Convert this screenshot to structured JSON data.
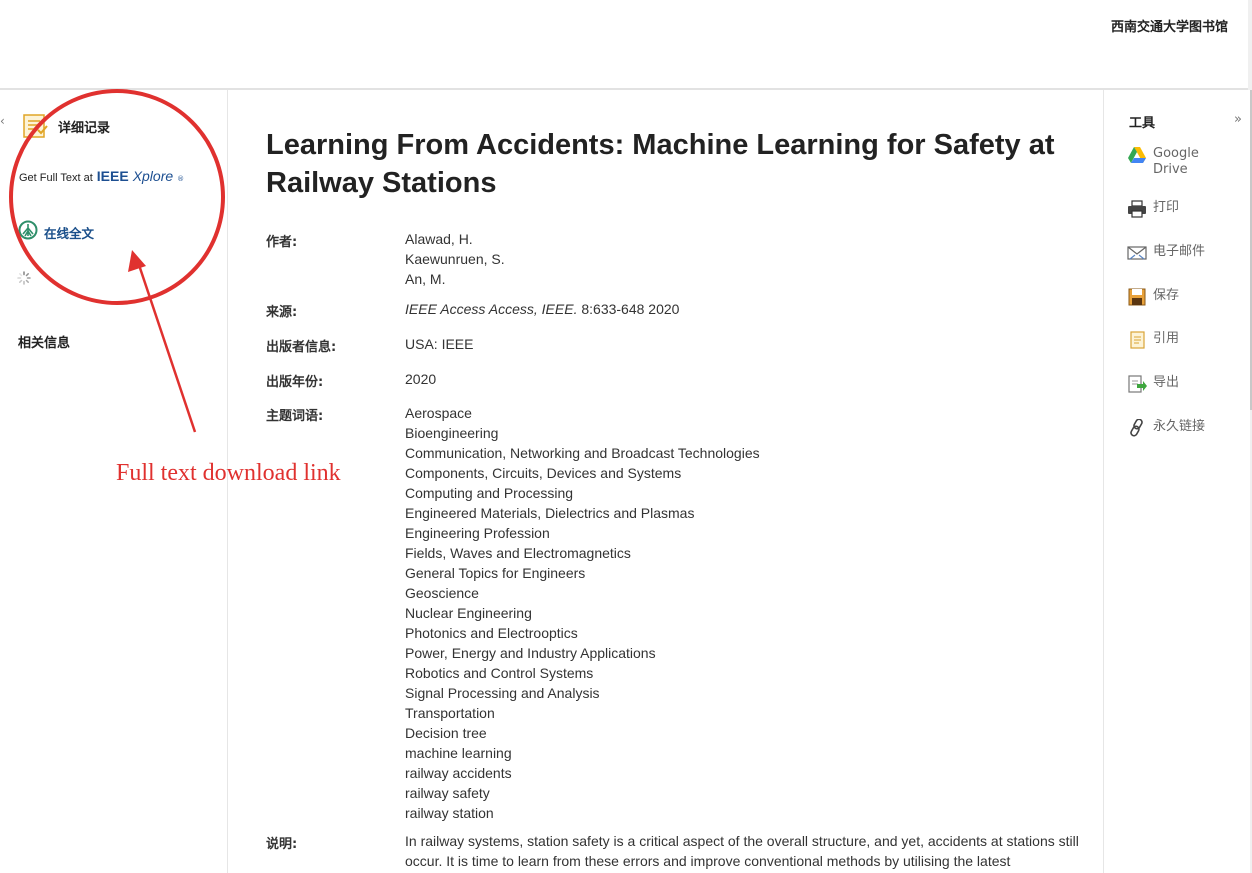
{
  "header": {
    "library_name": "西南交通大学图书馆"
  },
  "left_panel": {
    "collapse_glyph": "‹",
    "detail_label": "详细记录",
    "ieee_prefix": "Get Full Text at",
    "ieee_brand": "IEEE",
    "ieee_xplore": "Xplore",
    "ieee_reg": "®",
    "online_fulltext_label": "在线全文",
    "related_info_label": "相关信息"
  },
  "record": {
    "title": "Learning From Accidents: Machine Learning for Safety at Railway Stations",
    "authors_label": "作者:",
    "authors": [
      "Alawad, H.",
      "Kaewunruen, S.",
      "An, M."
    ],
    "source_label": "来源:",
    "source_journal": "IEEE Access Access, IEEE.",
    "source_detail": "8:633-648 2020",
    "publisher_label": "出版者信息:",
    "publisher": "USA: IEEE",
    "year_label": "出版年份:",
    "year": "2020",
    "subjects_label": "主题词语:",
    "subjects": [
      "Aerospace",
      "Bioengineering",
      "Communication, Networking and Broadcast Technologies",
      "Components, Circuits, Devices and Systems",
      "Computing and Processing",
      "Engineered Materials, Dielectrics and Plasmas",
      "Engineering Profession",
      "Fields, Waves and Electromagnetics",
      "General Topics for Engineers",
      "Geoscience",
      "Nuclear Engineering",
      "Photonics and Electrooptics",
      "Power, Energy and Industry Applications",
      "Robotics and Control Systems",
      "Signal Processing and Analysis",
      "Transportation",
      "Decision tree",
      "machine learning",
      "railway accidents",
      "railway safety",
      "railway station"
    ],
    "description_label": "说明:",
    "description": "In railway systems, station safety is a critical aspect of the overall structure, and yet, accidents at stations still occur. It is time to learn from these errors and improve conventional methods by utilising the latest"
  },
  "tools": {
    "title": "工具",
    "expand_glyph": "»",
    "items": [
      {
        "label": "Google Drive",
        "icon": "google-drive-icon"
      },
      {
        "label": "打印",
        "icon": "printer-icon"
      },
      {
        "label": "电子邮件",
        "icon": "email-icon"
      },
      {
        "label": "保存",
        "icon": "save-icon"
      },
      {
        "label": "引用",
        "icon": "cite-icon"
      },
      {
        "label": "导出",
        "icon": "export-icon"
      },
      {
        "label": "永久链接",
        "icon": "permalink-icon"
      }
    ]
  },
  "annotation": {
    "text": "Full text download link",
    "color": "#e0312f"
  },
  "colors": {
    "link_blue": "#1a4f8a",
    "ieee_blue": "#1d4f91",
    "annotation_red": "#e0312f"
  }
}
